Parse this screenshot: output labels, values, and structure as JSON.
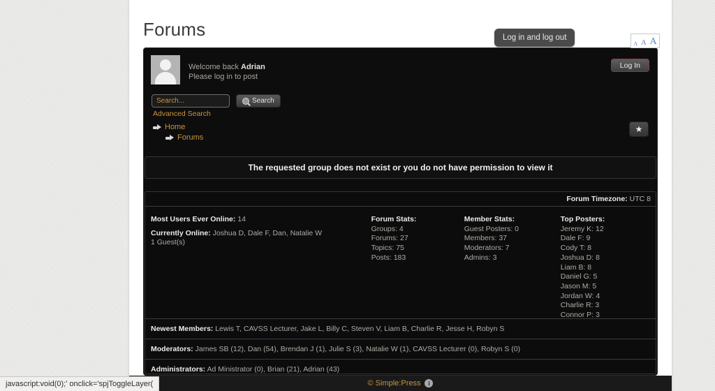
{
  "page": {
    "title": "Forums"
  },
  "text_resize": {
    "small": "A",
    "medium": "A",
    "large": "A"
  },
  "user": {
    "welcome_prefix": "Welcome back ",
    "name": "Adrian",
    "subtitle": "Please log in to post"
  },
  "search": {
    "placeholder": "Search...",
    "value": "",
    "button_label": "Search",
    "advanced_label": "Advanced Search"
  },
  "breadcrumb": {
    "home": "Home",
    "forums": "Forums"
  },
  "login": {
    "button_label": "Log In",
    "tooltip": "Log in and log out"
  },
  "star_button": {
    "glyph": "★"
  },
  "error": {
    "message": "The requested group does not exist or you do not have permission to view it"
  },
  "timezone": {
    "label": "Forum Timezone:",
    "value": "UTC 8"
  },
  "online": {
    "most_label": "Most Users Ever Online:",
    "most_value": "14",
    "current_label": "Currently Online:",
    "current_value": "Joshua D, Dale F, Dan, Natalie W",
    "guests": "1 Guest(s)"
  },
  "forum_stats": {
    "title": "Forum Stats:",
    "items": [
      "Groups: 4",
      "Forums: 27",
      "Topics: 75",
      "Posts: 183"
    ]
  },
  "member_stats": {
    "title": "Member Stats:",
    "items": [
      "Guest Posters: 0",
      "Members: 37",
      "Moderators: 7",
      "Admins: 3"
    ]
  },
  "top_posters": {
    "title": "Top Posters:",
    "items": [
      "Jeremy K: 12",
      "Dale F: 9",
      "Cody T: 8",
      "Joshua D: 8",
      "Liam B: 8",
      "Daniel G: 5",
      "Jason M: 5",
      "Jordan W: 4",
      "Charlie R: 3",
      "Connor P: 3"
    ]
  },
  "newest_members": {
    "label": "Newest Members:",
    "value": "Lewis T, CAVSS Lecturer, Jake L, Billy C, Steven V, Liam B, Charlie R, Jesse H, Robyn S"
  },
  "moderators": {
    "label": "Moderators:",
    "value": "James SB (12), Dan (54), Brendan J (1), Julie S (3), Natalie W (1), CAVSS Lecturer (0), Robyn S (0)"
  },
  "administrators": {
    "label": "Administrators:",
    "value": "Ad Ministrator (0), Brian (21), Adrian (43)"
  },
  "footer": {
    "copyright": "© Simple:Press",
    "info_glyph": "i"
  },
  "status_bar": {
    "text": "javascript:void(0);' onclick='spjToggleLayer("
  }
}
